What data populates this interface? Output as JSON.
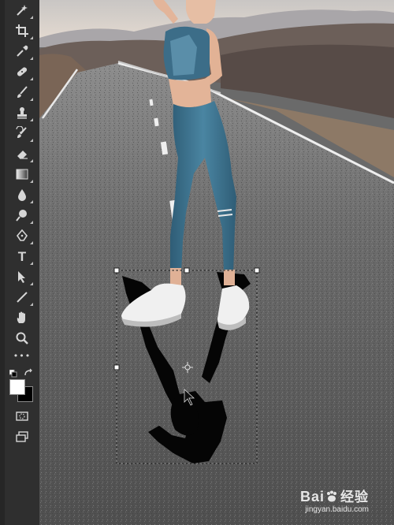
{
  "tools": [
    {
      "name": "magic-wand-icon"
    },
    {
      "name": "crop-icon"
    },
    {
      "name": "eyedropper-icon"
    },
    {
      "name": "healing-brush-icon"
    },
    {
      "name": "brush-icon"
    },
    {
      "name": "clone-stamp-icon"
    },
    {
      "name": "history-brush-icon"
    },
    {
      "name": "eraser-icon"
    },
    {
      "name": "gradient-icon"
    },
    {
      "name": "blur-icon"
    },
    {
      "name": "dodge-icon"
    },
    {
      "name": "pen-icon"
    },
    {
      "name": "type-icon"
    },
    {
      "name": "path-selection-icon"
    },
    {
      "name": "line-icon"
    },
    {
      "name": "hand-icon"
    },
    {
      "name": "zoom-icon"
    },
    {
      "name": "more-tools-icon"
    }
  ],
  "type_tool_glyph": "T",
  "more_tools_glyph": "•••",
  "colors": {
    "foreground": "#ffffff",
    "background": "#000000",
    "sky": "#dcd6d0",
    "road": "#5c5c5c",
    "outfit": "#3d6f8a"
  },
  "watermark": {
    "brand": "Bai",
    "brand_cn": "经验",
    "url": "jingyan.baidu.com"
  }
}
